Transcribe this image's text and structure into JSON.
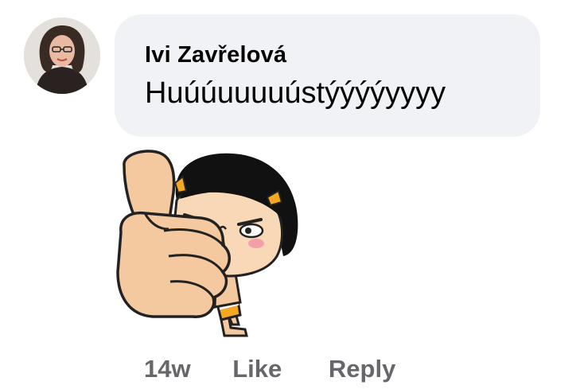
{
  "comment": {
    "author": "Ivi Zavřelová",
    "text": "Huúúuuuuústýýýýyyyy",
    "timestamp": "14w",
    "like_label": "Like",
    "reply_label": "Reply"
  },
  "colors": {
    "bubble_background": "#f0f2f5",
    "text_primary": "#050505",
    "text_secondary": "#65676b"
  },
  "icons": {
    "avatar": "profile-photo",
    "sticker": "thumbs-up-girl-sticker"
  }
}
